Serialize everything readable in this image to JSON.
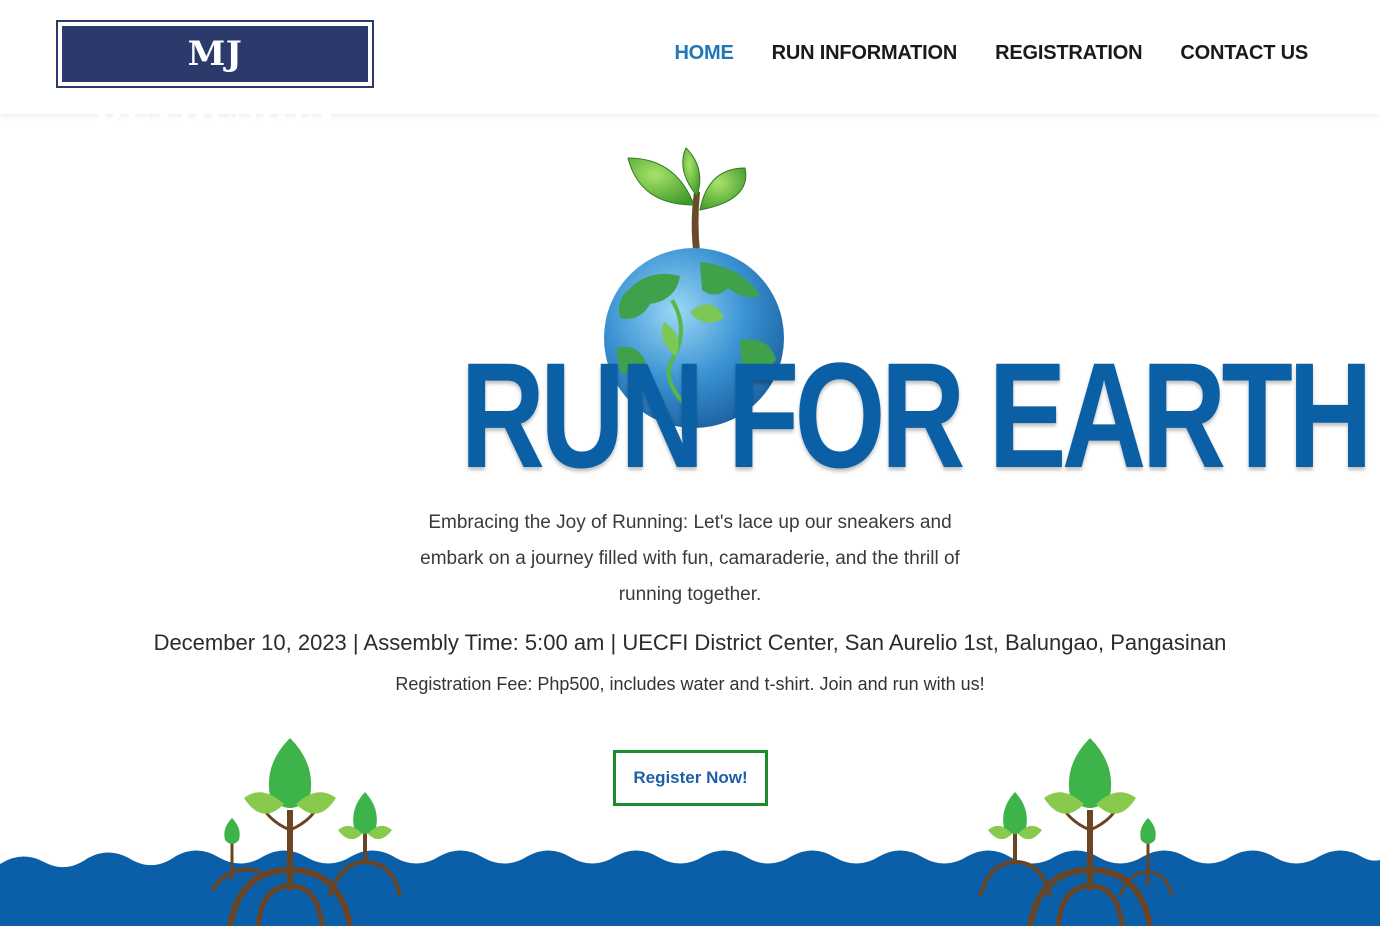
{
  "header": {
    "logo_text": "MJ DEVDESIGN",
    "nav": [
      {
        "label": "HOME",
        "active": true
      },
      {
        "label": "RUN INFORMATION",
        "active": false
      },
      {
        "label": "REGISTRATION",
        "active": false
      },
      {
        "label": "CONTACT US",
        "active": false
      }
    ]
  },
  "hero": {
    "title": "RUN FOR EARTH",
    "tagline": "Embracing the Joy of Running: Let's lace up our sneakers and embark on a journey filled with fun, camaraderie, and the thrill of running together.",
    "event_details": "December 10, 2023 | Assembly Time: 5:00 am | UECFI District Center, San Aurelio 1st, Balungao, Pangasinan",
    "fee": "Registration Fee: Php500, includes water and t-shirt. Join and run with us!",
    "register_label": "Register Now!"
  },
  "colors": {
    "brand_navy": "#2c3a6b",
    "nav_active": "#1f77b8",
    "title_blue": "#0a5fa5",
    "water_blue": "#0b5ea8",
    "button_border": "#1a8c2e",
    "leaf_green": "#3fae49"
  },
  "icons": [
    "globe-sprout-icon",
    "mangrove-tree-icon"
  ]
}
